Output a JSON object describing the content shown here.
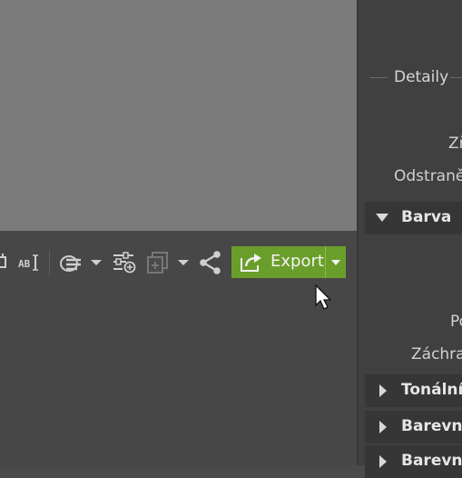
{
  "toolbar": {
    "export_label": "Export",
    "export_color": "#6a9e2a",
    "icons": [
      "crop-icon",
      "rename-icon",
      "layers-icon",
      "dropdown-icon",
      "adjustments-icon",
      "copy-icon",
      "dropdown-icon",
      "share-icon"
    ]
  },
  "right_panel": {
    "details_label": "Detaily",
    "props": [
      "Zř",
      "Odstraně",
      "Po",
      "Záchran"
    ],
    "sections": [
      {
        "label": "Barva",
        "expanded": true
      },
      {
        "label": "Tonální",
        "expanded": false
      },
      {
        "label": "Barevné",
        "expanded": false
      },
      {
        "label": "Barevné",
        "expanded": false
      }
    ]
  }
}
